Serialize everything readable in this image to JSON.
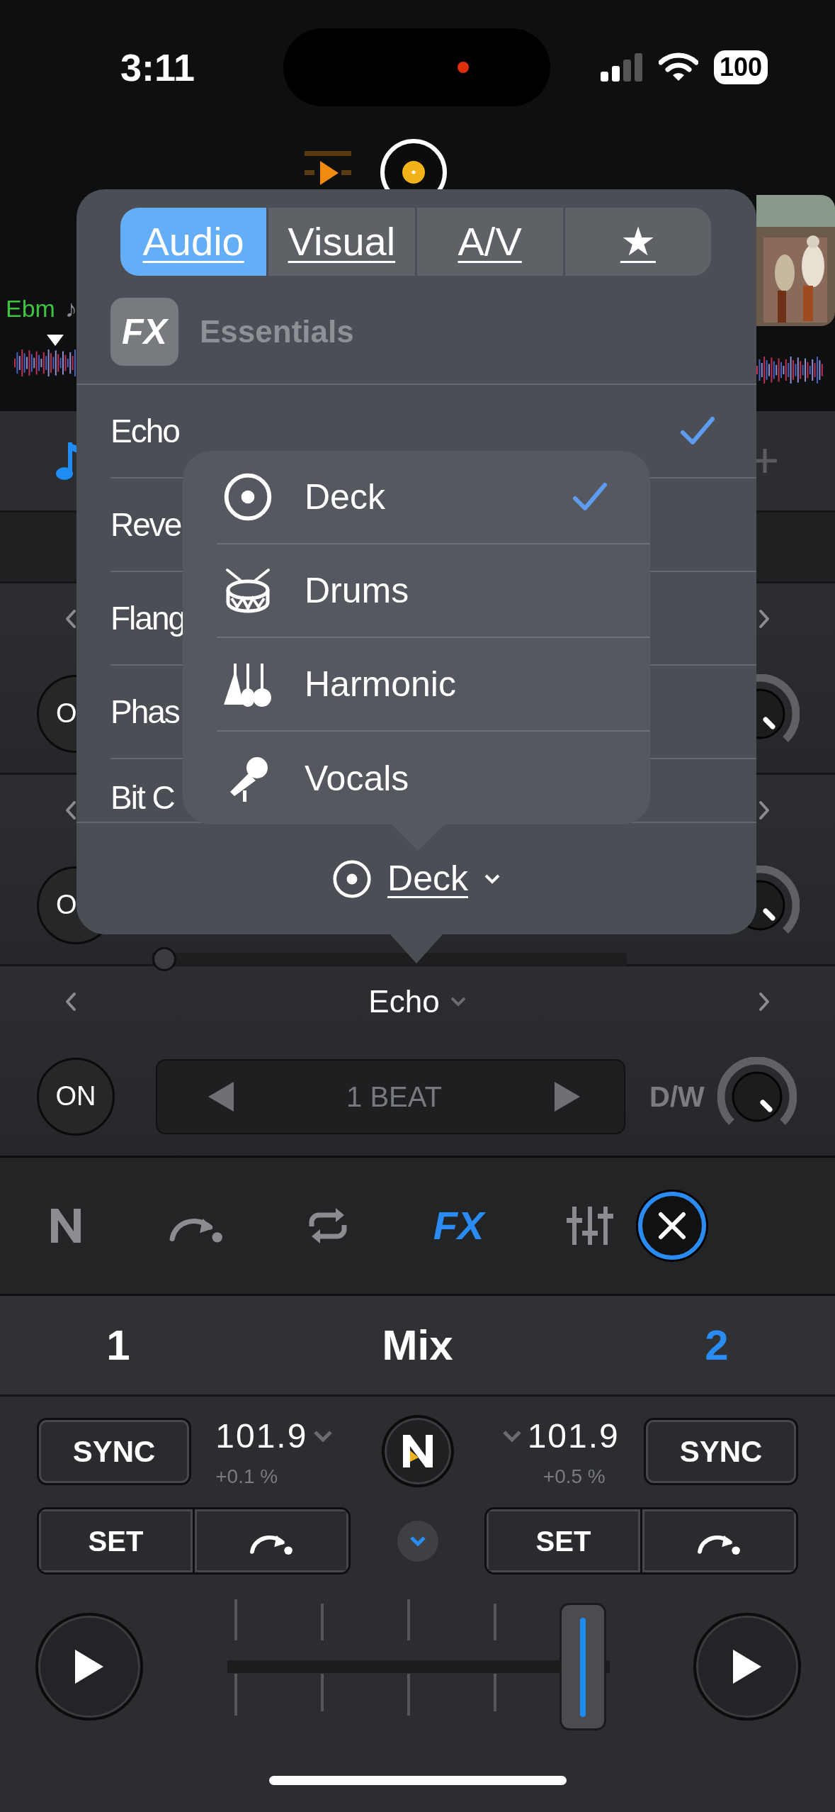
{
  "status_bar": {
    "time": "3:11",
    "battery": "100"
  },
  "deck_header": {
    "key": "Ebm",
    "note": "♪"
  },
  "fx_rows": [
    {
      "on_label": "O"
    },
    {
      "on_label": "O",
      "slider": {
        "level": 0
      }
    }
  ],
  "fx_unit": {
    "effect": "Echo",
    "on_label": "ON",
    "beat": "1 BEAT",
    "knob_label": "D/W"
  },
  "toolbar": [
    {
      "kind": "nexus",
      "selected": false
    },
    {
      "kind": "cue",
      "selected": false
    },
    {
      "kind": "loop",
      "selected": false
    },
    {
      "kind": "fx",
      "label": "FX",
      "selected": true
    },
    {
      "kind": "mixer",
      "selected": false
    }
  ],
  "mix_header": {
    "tabs": [
      {
        "label": "1",
        "selected": false
      },
      {
        "label": "2",
        "selected": true
      }
    ],
    "title": "Mix"
  },
  "decks": [
    {
      "sync": "SYNC",
      "bpm": "101.9",
      "pitch": "+0.1 %",
      "set": "SET"
    },
    {
      "sync": "SYNC",
      "bpm": "101.9",
      "pitch": "+0.5 %",
      "set": "SET"
    }
  ],
  "popover": {
    "tabs": [
      {
        "label": "Audio",
        "selected": true
      },
      {
        "label": "Visual",
        "selected": false
      },
      {
        "label": "A/V",
        "selected": false
      },
      {
        "label": "★",
        "selected": false
      }
    ],
    "badge": "FX",
    "category": "Essentials",
    "effects": [
      {
        "label": "Echo",
        "checked": true
      },
      {
        "label": "Reve",
        "checked": false
      },
      {
        "label": "Flang",
        "checked": false
      },
      {
        "label": "Phas",
        "checked": false
      },
      {
        "label": "Bit C",
        "checked": false
      }
    ],
    "source": "Deck"
  },
  "source_menu": {
    "items": [
      {
        "kind": "deck",
        "label": "Deck",
        "checked": true
      },
      {
        "kind": "drums",
        "label": "Drums",
        "checked": false
      },
      {
        "kind": "harmonic",
        "label": "Harmonic",
        "checked": false
      },
      {
        "kind": "vocals",
        "label": "Vocals",
        "checked": false
      }
    ]
  }
}
